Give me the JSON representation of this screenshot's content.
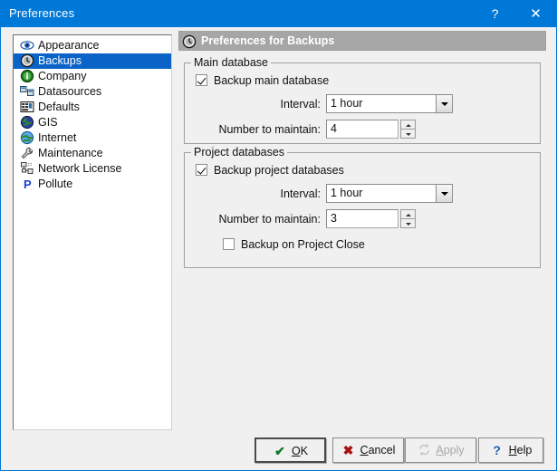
{
  "window": {
    "title": "Preferences",
    "help_button": "?",
    "close_button": "✕",
    "accent_color": "#0078d7",
    "face_color": "#f0f0f0"
  },
  "sidebar": {
    "selected": "Backups",
    "items": [
      {
        "label": "Appearance",
        "icon": "eye-icon"
      },
      {
        "label": "Backups",
        "icon": "clock-icon"
      },
      {
        "label": "Company",
        "icon": "info-circle-icon"
      },
      {
        "label": "Datasources",
        "icon": "databases-icon"
      },
      {
        "label": "Defaults",
        "icon": "grid-icon"
      },
      {
        "label": "GIS",
        "icon": "globe-dark-icon"
      },
      {
        "label": "Internet",
        "icon": "globe-green-icon"
      },
      {
        "label": "Maintenance",
        "icon": "wrench-icon"
      },
      {
        "label": "Network License",
        "icon": "network-icon"
      },
      {
        "label": "Pollute",
        "icon": "letter-p-icon"
      }
    ]
  },
  "panel": {
    "header_title": "Preferences for Backups",
    "header_icon": "clock-icon",
    "groups": [
      {
        "legend": "Main database",
        "enable_checkbox": {
          "label": "Backup main database",
          "checked": true
        },
        "interval_label": "Interval:",
        "interval_value": "1 hour",
        "interval_options": [
          "1 hour"
        ],
        "maintain_label": "Number to maintain:",
        "maintain_value": "4"
      },
      {
        "legend": "Project databases",
        "enable_checkbox": {
          "label": "Backup project databases",
          "checked": true
        },
        "interval_label": "Interval:",
        "interval_value": "1 hour",
        "interval_options": [
          "1 hour"
        ],
        "maintain_label": "Number to maintain:",
        "maintain_value": "3",
        "close_checkbox": {
          "label": "Backup on Project Close",
          "checked": false
        }
      }
    ]
  },
  "buttons": {
    "ok": {
      "label": "OK",
      "accel": "O",
      "icon": "check-icon",
      "enabled": true,
      "default": true
    },
    "cancel": {
      "label": "Cancel",
      "accel": "C",
      "icon": "x-icon",
      "enabled": true,
      "default": false
    },
    "apply": {
      "label": "Apply",
      "accel": "A",
      "icon": "refresh-icon",
      "enabled": false,
      "default": false
    },
    "help": {
      "label": "Help",
      "accel": "H",
      "icon": "question-icon",
      "enabled": true,
      "default": false
    }
  }
}
